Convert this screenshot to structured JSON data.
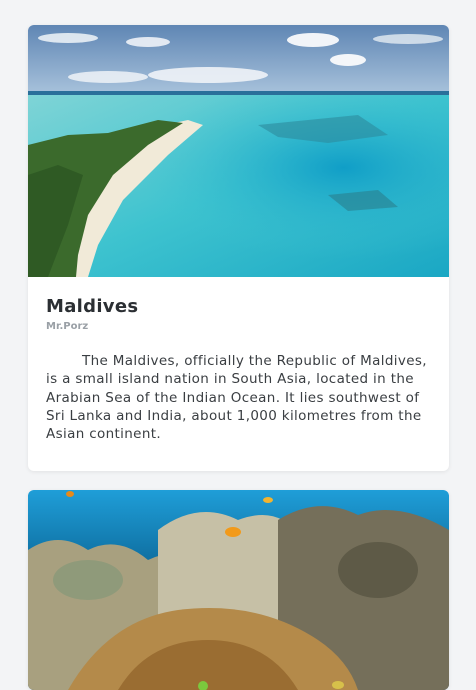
{
  "cards": [
    {
      "title": "Maldives",
      "author": "Mr.Porz",
      "description": "The Maldives, officially the Republic of Maldives, is a small island nation in South Asia, located in the Arabian Sea of the Indian Ocean. It lies southwest of Sri Lanka and India, about 1,000 kilometres from the Asian continent."
    }
  ],
  "colors": {
    "page_background": "#f3f4f6",
    "card_background": "#ffffff",
    "title": "#2b2f33",
    "author": "#9aa0a6"
  }
}
